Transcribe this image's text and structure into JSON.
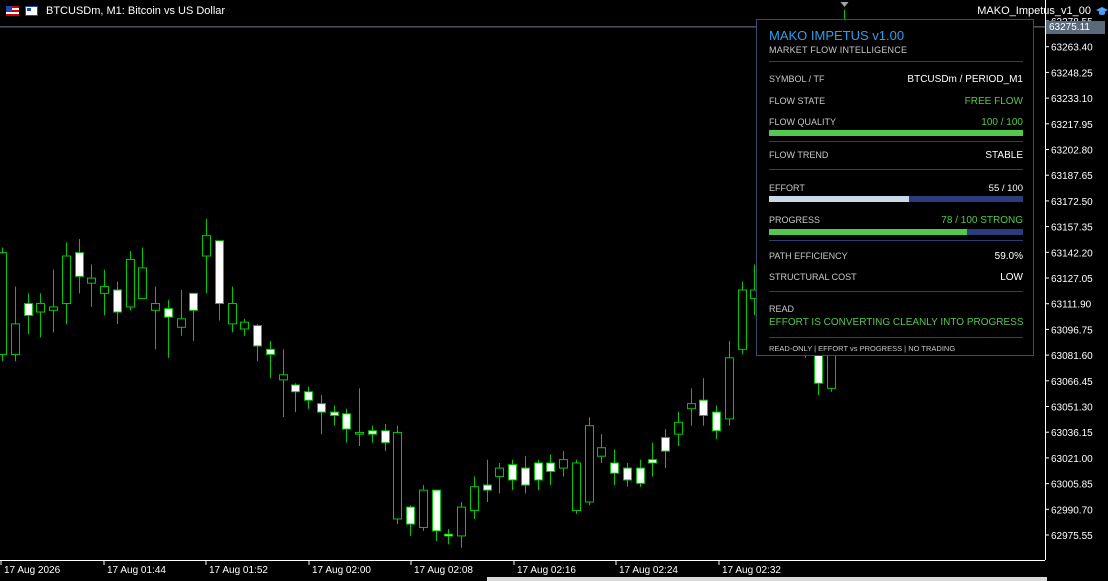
{
  "window": {
    "symbol_title": "BTCUSDm, M1:  Bitcoin vs US Dollar",
    "indicator_name": "MAKO_Impetus_v1_00",
    "current_price": "63275.11"
  },
  "panel": {
    "title": "MAKO IMPETUS v1.00",
    "subtitle": "MARKET FLOW INTELLIGENCE",
    "symbol_label": "SYMBOL / TF",
    "symbol_value": "BTCUSDm / PERIOD_M1",
    "flow_state_label": "FLOW STATE",
    "flow_state_value": "FREE FLOW",
    "flow_quality_label": "FLOW QUALITY",
    "flow_quality_value": "100 / 100",
    "flow_quality_fraction": 1.0,
    "flow_trend_label": "FLOW TREND",
    "flow_trend_value": "STABLE",
    "effort_label": "EFFORT",
    "effort_value": "55 / 100",
    "effort_fraction": 0.55,
    "progress_label": "PROGRESS",
    "progress_value": "78 / 100  STRONG",
    "progress_fraction": 0.78,
    "path_eff_label": "PATH EFFICIENCY",
    "path_eff_value": "59.0%",
    "struct_cost_label": "STRUCTURAL COST",
    "struct_cost_value": "LOW",
    "read_label": "READ",
    "read_text": "EFFORT IS CONVERTING CLEANLY INTO PROGRESS",
    "footer": "READ-ONLY  |  EFFORT vs PROGRESS  |  NO TRADING"
  },
  "colors": {
    "bull_candle": "#ffffff",
    "bear_candle": "#000000",
    "candle_outline": "#00c800",
    "accent_blue": "#2f9fe8",
    "positive_green": "#53c84f",
    "bar_track": "#2a3d7a",
    "effort_fill": "#c9d9e9"
  },
  "chart_data": {
    "type": "candlestick",
    "symbol": "BTCUSDm",
    "timeframe": "M1",
    "y_ticks": [
      "63278.55",
      "63263.40",
      "63248.25",
      "63233.10",
      "63217.95",
      "63202.80",
      "63187.65",
      "63172.50",
      "63157.35",
      "63142.20",
      "63127.05",
      "63111.90",
      "63096.75",
      "63081.60",
      "63066.45",
      "63051.30",
      "63036.15",
      "63021.00",
      "63005.85",
      "62990.70",
      "62975.55"
    ],
    "x_ticks": [
      "17 Aug 2026",
      "17 Aug 01:44",
      "17 Aug 01:52",
      "17 Aug 02:00",
      "17 Aug 02:08",
      "17 Aug 02:16",
      "17 Aug 02:24",
      "17 Aug 02:32"
    ],
    "ylim": [
      62968,
      63285
    ],
    "candles": [
      [
        63142,
        63145,
        63078,
        63082
      ],
      [
        63100,
        63122,
        63078,
        63082
      ],
      [
        63105,
        63118,
        63094,
        63112
      ],
      [
        63112,
        63118,
        63092,
        63107
      ],
      [
        63110,
        63132,
        63095,
        63108
      ],
      [
        63140,
        63148,
        63100,
        63112
      ],
      [
        63128,
        63150,
        63118,
        63142
      ],
      [
        63127,
        63135,
        63110,
        63124
      ],
      [
        63122,
        63132,
        63105,
        63118
      ],
      [
        63107,
        63125,
        63100,
        63120
      ],
      [
        63138,
        63143,
        63108,
        63110
      ],
      [
        63133,
        63145,
        63115,
        63115
      ],
      [
        63112,
        63122,
        63085,
        63108
      ],
      [
        63104,
        63114,
        63080,
        63109
      ],
      [
        63103,
        63120,
        63093,
        63098
      ],
      [
        63108,
        63118,
        63090,
        63118
      ],
      [
        63152,
        63162,
        63118,
        63140
      ],
      [
        63112,
        63148,
        63102,
        63149
      ],
      [
        63112,
        63122,
        63095,
        63100
      ],
      [
        63101,
        63103,
        63093,
        63097
      ],
      [
        63087,
        63100,
        63078,
        63099
      ],
      [
        63082,
        63090,
        63068,
        63085
      ],
      [
        63070,
        63085,
        63045,
        63067
      ],
      [
        63060,
        63065,
        63048,
        63064
      ],
      [
        63055,
        63063,
        63050,
        63060
      ],
      [
        63048,
        63058,
        63035,
        63053
      ],
      [
        63046,
        63052,
        63040,
        63048
      ],
      [
        63038,
        63050,
        63030,
        63047
      ],
      [
        63036,
        63062,
        63028,
        63035
      ],
      [
        63035,
        63040,
        63030,
        63037
      ],
      [
        63030,
        63041,
        63025,
        63037
      ],
      [
        63036,
        63040,
        62982,
        62985
      ],
      [
        62982,
        62993,
        62975,
        62992
      ],
      [
        63002,
        63005,
        62978,
        62980
      ],
      [
        62978,
        62999,
        62972,
        63002
      ],
      [
        62975,
        62979,
        62970,
        62976
      ],
      [
        62992,
        62995,
        62968,
        62975
      ],
      [
        63004,
        63010,
        62985,
        62990
      ],
      [
        63002,
        63020,
        62995,
        63005
      ],
      [
        63015,
        63018,
        63000,
        63010
      ],
      [
        63008,
        63020,
        63002,
        63017
      ],
      [
        63005,
        63022,
        63000,
        63015
      ],
      [
        63008,
        63020,
        63002,
        63018
      ],
      [
        63013,
        63023,
        63005,
        63018
      ],
      [
        63020,
        63025,
        63010,
        63015
      ],
      [
        63018,
        63020,
        62988,
        62990
      ],
      [
        63040,
        63045,
        62993,
        62995
      ],
      [
        63027,
        63035,
        63018,
        63022
      ],
      [
        63012,
        63026,
        63005,
        63018
      ],
      [
        63008,
        63018,
        63004,
        63015
      ],
      [
        63006,
        63020,
        63004,
        63015
      ],
      [
        63018,
        63030,
        63010,
        63020
      ],
      [
        63025,
        63038,
        63015,
        63033
      ],
      [
        63042,
        63048,
        63028,
        63035
      ],
      [
        63053,
        63062,
        63040,
        63050
      ],
      [
        63046,
        63068,
        63040,
        63055
      ],
      [
        63037,
        63052,
        63032,
        63048
      ],
      [
        63080,
        63090,
        63040,
        63044
      ],
      [
        63120,
        63125,
        63082,
        63085
      ],
      [
        63120,
        63135,
        63105,
        63115
      ],
      [
        63111,
        63120,
        63100,
        63113
      ],
      [
        63105,
        63112,
        63096,
        63107
      ],
      [
        63102,
        63110,
        63100,
        63104
      ],
      [
        63100,
        63110,
        63080,
        63086
      ],
      [
        63065,
        63085,
        63058,
        63082
      ],
      [
        63255,
        63268,
        63060,
        63062
      ],
      [
        63265,
        63285,
        63250,
        63272
      ]
    ]
  }
}
